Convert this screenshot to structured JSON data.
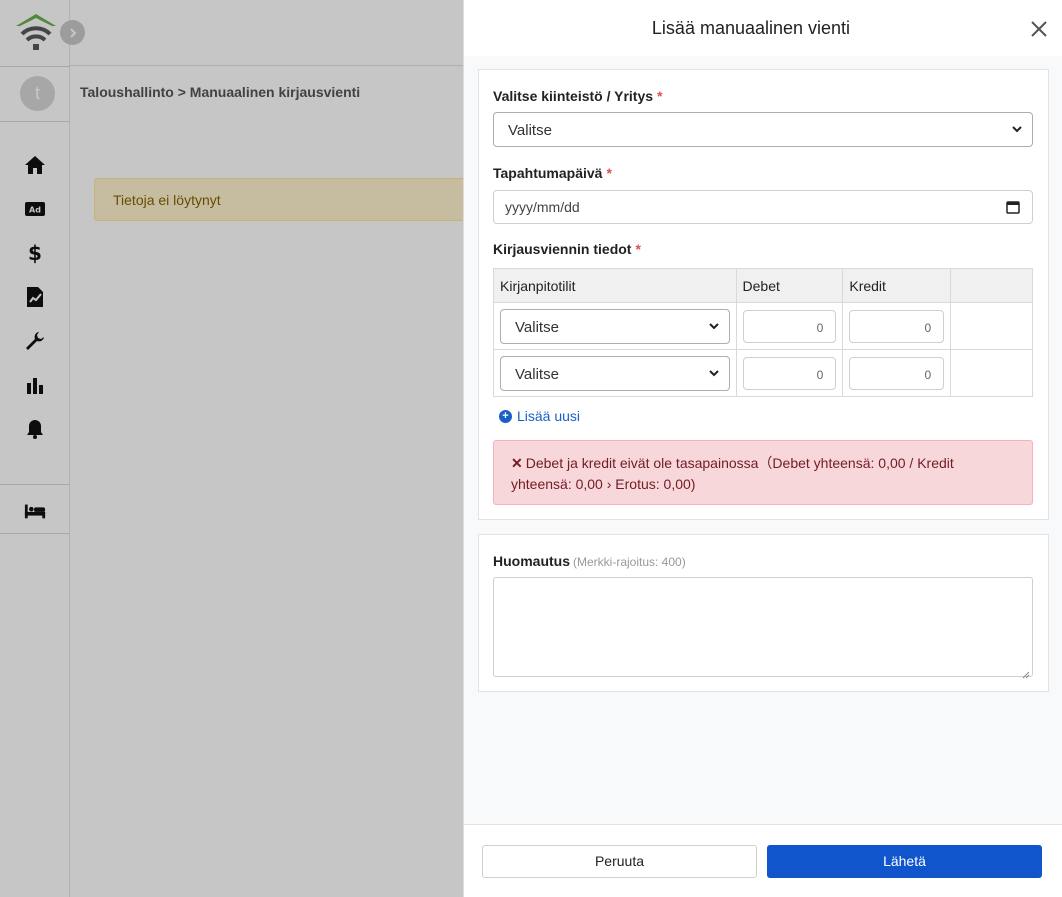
{
  "app": {
    "avatar_letter": "t",
    "breadcrumb": "Taloushallinto > Manuaalinen kirjausvienti",
    "notice": "Tietoja ei löytynyt",
    "sidebar_icons": [
      "home-icon",
      "ad-icon",
      "dollar-icon",
      "report-icon",
      "wrench-icon",
      "bar-chart-icon",
      "bell-icon",
      "bed-icon"
    ]
  },
  "drawer": {
    "title": "Lisää manuaalinen vienti",
    "property_label": "Valitse kiinteistö / Yritys",
    "property_select_value": "Valitse",
    "date_label": "Tapahtumapäivä",
    "date_placeholder": "yyyy/mm/dd",
    "entries_label": "Kirjausviennin tiedot",
    "required_mark": "*",
    "table": {
      "headers": [
        "Kirjanpitotilit",
        "Debet",
        "Kredit",
        ""
      ],
      "rows": [
        {
          "account": "Valitse",
          "debit": "0",
          "credit": "0"
        },
        {
          "account": "Valitse",
          "debit": "0",
          "credit": "0"
        }
      ]
    },
    "add_new_label": "Lisää uusi",
    "alert_text": "Debet ja kredit eivät ole tasapainossa（Debet yhteensä: 0,00 / Kredit yhteensä: 0,00 › Erotus: 0,00)",
    "alert_icon": "✕",
    "note_label": "Huomautus",
    "note_hint": "(Merkki-rajoitus: 400)",
    "note_value": "",
    "cancel_label": "Peruuta",
    "submit_label": "Lähetä"
  },
  "colors": {
    "primary": "#1155cc",
    "link": "#1a5fc7",
    "alert_bg": "#f8d7da",
    "alert_text": "#721c24",
    "notice_bg": "#fff3cd",
    "logo_green": "#6ab04c",
    "logo_gray": "#5a5a5a"
  }
}
